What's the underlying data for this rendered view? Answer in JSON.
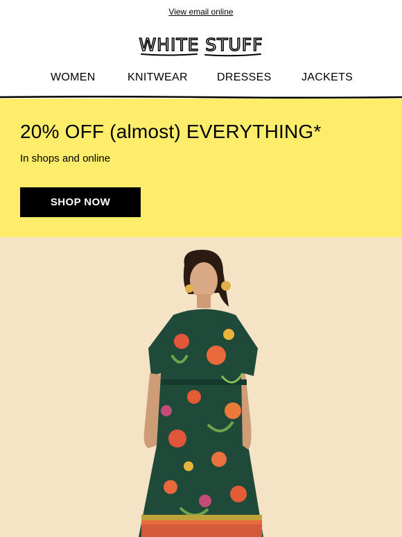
{
  "topbar": {
    "view_online": "View email online"
  },
  "brand": {
    "logo_text": "WHITE STUFF"
  },
  "nav": {
    "items": [
      "WOMEN",
      "KNITWEAR",
      "DRESSES",
      "JACKETS"
    ]
  },
  "promo": {
    "headline": "20% OFF (almost) EVERYTHING*",
    "subline": "In shops and online",
    "cta_label": "SHOP NOW",
    "background": "#fded6a"
  },
  "hero": {
    "background": "#f5e3c6"
  }
}
